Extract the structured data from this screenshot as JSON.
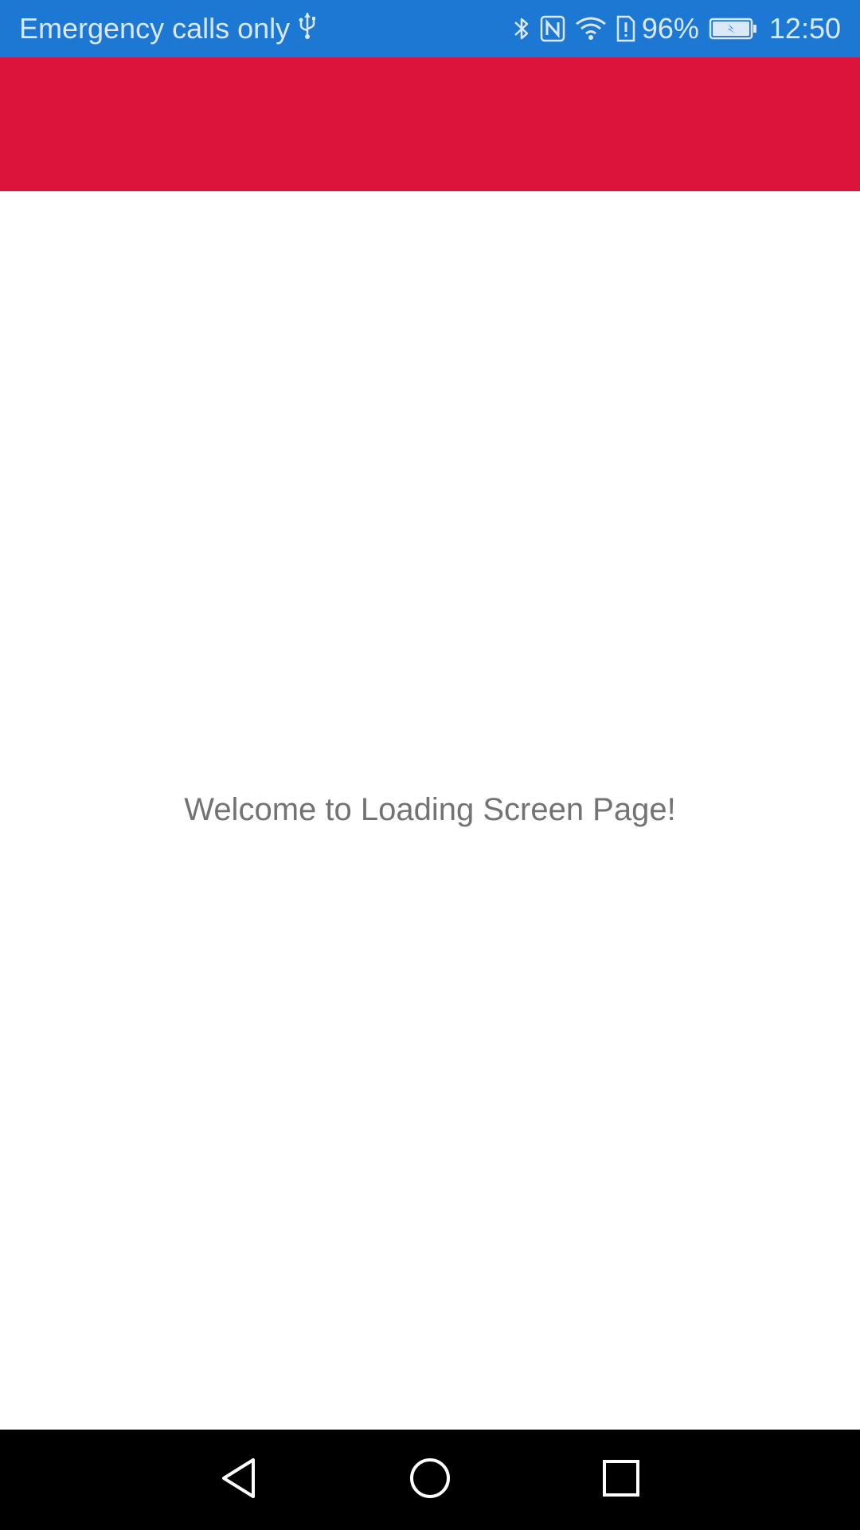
{
  "status_bar": {
    "carrier_text": "Emergency calls only",
    "battery_percent": "96%",
    "time": "12:50",
    "color": "#1d78d4",
    "icons": [
      "usb-icon",
      "bluetooth-icon",
      "nfc-icon",
      "wifi-icon",
      "sim-alert-icon",
      "battery-charging-icon"
    ]
  },
  "app_bar": {
    "color": "#dc143c"
  },
  "main": {
    "welcome_text": "Welcome to Loading Screen Page!"
  },
  "nav_bar": {
    "buttons": [
      "back-icon",
      "home-icon",
      "recents-icon"
    ]
  }
}
